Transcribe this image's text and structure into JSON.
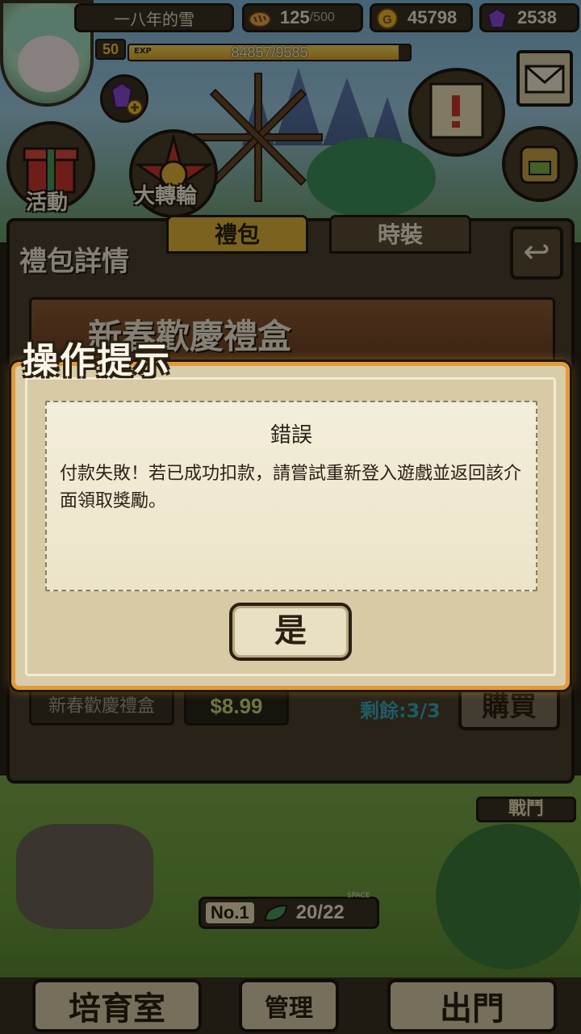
{
  "player": {
    "name": "一八年的雪",
    "level": "50",
    "exp_label": "EXP",
    "exp_text": "84857/9585",
    "exp_progress": 0.96
  },
  "resources": {
    "stamina_value": "125",
    "stamina_max": "/500",
    "gold": "45798",
    "gems": "2538"
  },
  "side_buttons": {
    "event_label": "活動",
    "wheel_label": "大轉輪"
  },
  "panel": {
    "title": "禮包詳情",
    "tabs": [
      "禮包",
      "時裝"
    ],
    "banner_title": "新春歡慶禮盒",
    "item_name": "新春歡慶禮盒",
    "item_price": "$8.99",
    "item_remaining": "剩餘:3/3",
    "buy_label": "購買"
  },
  "bottom": {
    "nursery_label": "培育室",
    "manage_label": "管理",
    "go_out_label": "出門",
    "battle_label": "戰鬥",
    "rank_prefix": "No.",
    "rank_value": "1",
    "space_tag": "SPACE",
    "space_text": "20/22"
  },
  "dialog": {
    "title": "操作提示",
    "heading": "錯誤",
    "message": "付款失敗！若已成功扣款，請嘗試重新登入遊戲並返回該介面領取獎勵。",
    "confirm_label": "是"
  },
  "colors": {
    "dialog_border": "#e39a3a",
    "price": "#c8d87a",
    "remaining": "#3aa6b8",
    "exp_fill": "#d9a526"
  }
}
